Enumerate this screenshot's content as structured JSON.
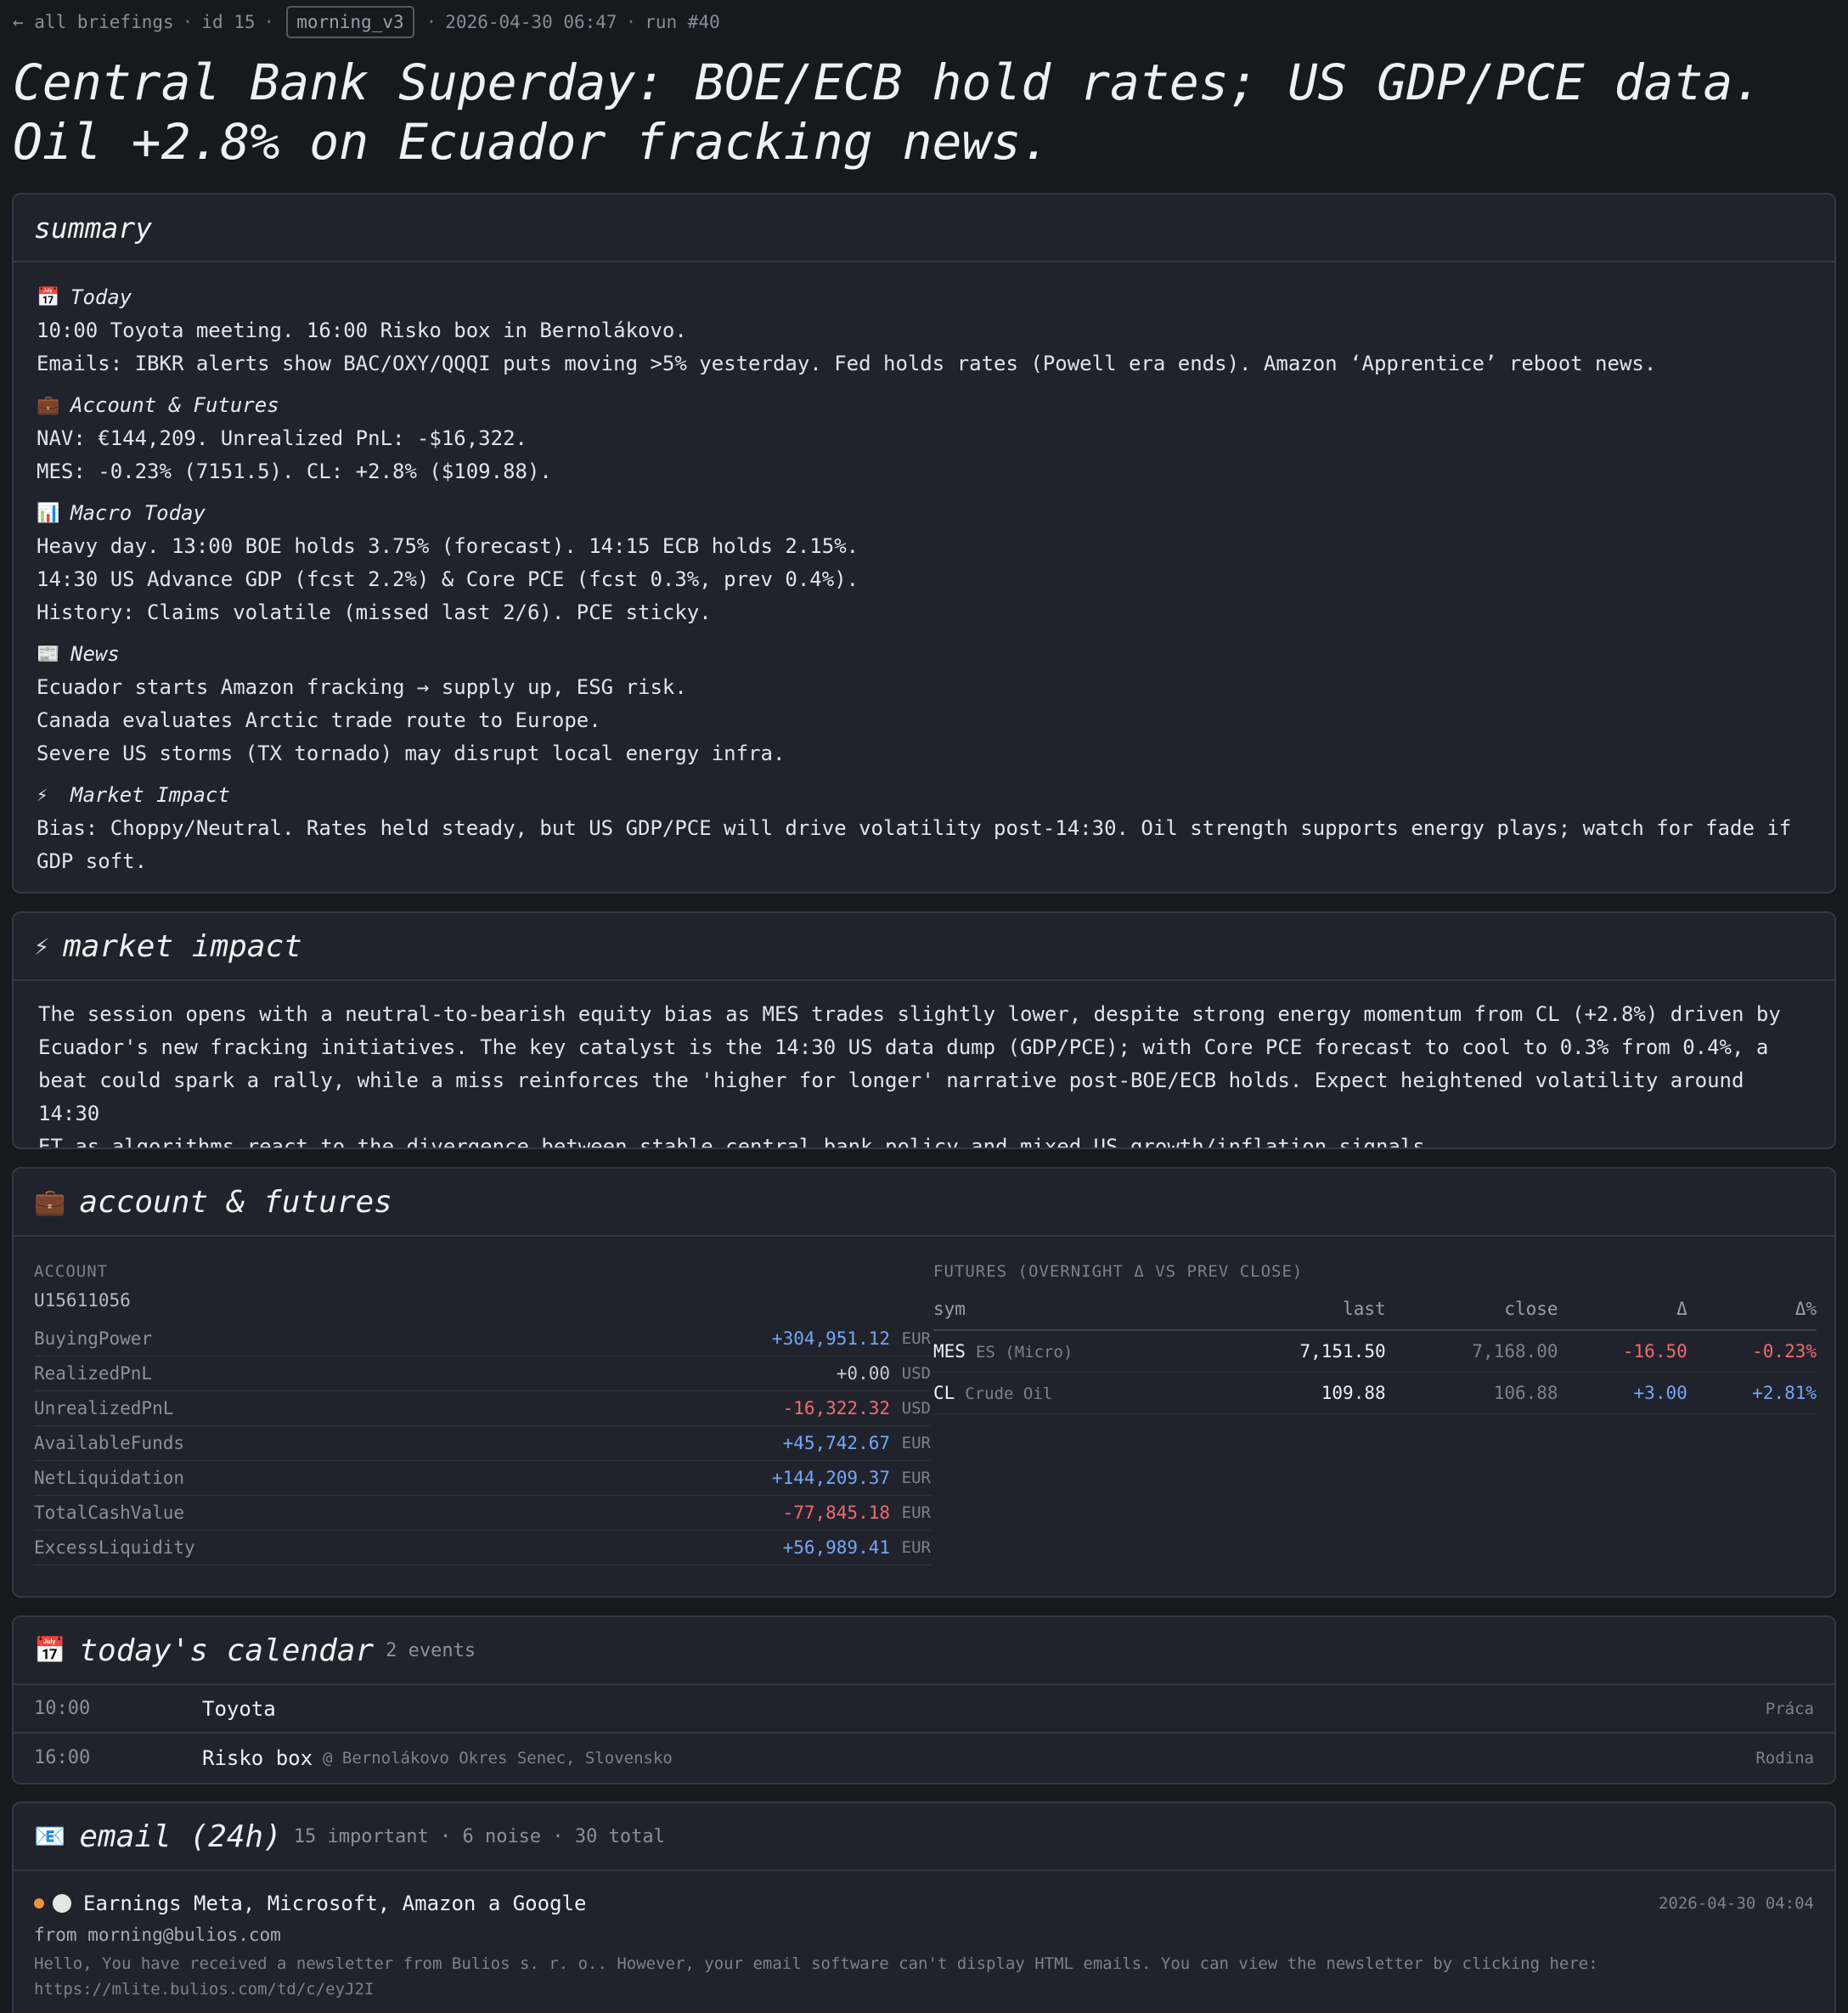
{
  "topbar": {
    "back": "← all briefings",
    "id": "id 15",
    "tag": "morning_v3",
    "timestamp": "2026-04-30 06:47",
    "run": "run #40"
  },
  "headline": "Central Bank Superday: BOE/ECB hold rates; US GDP/PCE data. Oil +2.8% on Ecuador fracking news.",
  "summary": {
    "title": "summary",
    "today_title": "Today",
    "today_lines": [
      "10:00 Toyota meeting. 16:00 Risko box in Bernolákovo.",
      "Emails: IBKR alerts show BAC/OXY/QQQI puts moving >5% yesterday. Fed holds rates (Powell era ends). Amazon ‘Apprentice’ reboot news."
    ],
    "account_title": "Account & Futures",
    "account_lines": [
      "NAV: €144,209. Unrealized PnL: -$16,322.",
      "MES: -0.23% (7151.5). CL: +2.8% ($109.88)."
    ],
    "macro_title": "Macro Today",
    "macro_lines": [
      "Heavy day. 13:00 BOE holds 3.75% (forecast). 14:15 ECB holds 2.15%.",
      "14:30 US Advance GDP (fcst 2.2%) & Core PCE (fcst 0.3%, prev 0.4%).",
      "History: Claims volatile (missed last 2/6). PCE sticky."
    ],
    "news_title": "News",
    "news_lines": [
      "Ecuador starts Amazon fracking → supply up, ESG risk.",
      "Canada evaluates Arctic trade route to Europe.",
      "Severe US storms (TX tornado) may disrupt local energy infra."
    ],
    "impact_title": "Market Impact",
    "impact_lines": [
      "Bias: Choppy/Neutral. Rates held steady, but US GDP/PCE will drive volatility post-14:30. Oil strength supports energy plays; watch for fade if",
      "GDP soft."
    ]
  },
  "market_impact": {
    "title": "market impact",
    "lines": [
      "The session opens with a neutral-to-bearish equity bias as MES trades slightly lower, despite strong energy momentum from CL (+2.8%) driven by",
      "Ecuador's new fracking initiatives. The key catalyst is the 14:30 US data dump (GDP/PCE); with Core PCE forecast to cool to 0.3% from 0.4%, a",
      "beat could spark a rally, while a miss reinforces the 'higher for longer' narrative post-BOE/ECB holds. Expect heightened volatility around 14:30",
      "ET as algorithms react to the divergence between stable central bank policy and mixed US growth/inflation signals."
    ]
  },
  "account_futures": {
    "title": "account & futures",
    "account_caption": "ACCOUNT",
    "account_id": "U15611056",
    "rows": [
      {
        "key": "BuyingPower",
        "value": "+304,951.12",
        "cur": "EUR",
        "sign": "pos"
      },
      {
        "key": "RealizedPnL",
        "value": "+0.00",
        "cur": "USD",
        "sign": "neu"
      },
      {
        "key": "UnrealizedPnL",
        "value": "-16,322.32",
        "cur": "USD",
        "sign": "neg"
      },
      {
        "key": "AvailableFunds",
        "value": "+45,742.67",
        "cur": "EUR",
        "sign": "pos"
      },
      {
        "key": "NetLiquidation",
        "value": "+144,209.37",
        "cur": "EUR",
        "sign": "pos"
      },
      {
        "key": "TotalCashValue",
        "value": "-77,845.18",
        "cur": "EUR",
        "sign": "neg"
      },
      {
        "key": "ExcessLiquidity",
        "value": "+56,989.41",
        "cur": "EUR",
        "sign": "pos"
      }
    ],
    "futures_caption": "FUTURES (OVERNIGHT Δ VS PREV CLOSE)",
    "futures_headers": {
      "sym": "sym",
      "last": "last",
      "close": "close",
      "delta": "Δ",
      "pct": "Δ%"
    },
    "futures": [
      {
        "sym": "MES",
        "desc": "ES (Micro)",
        "last": "7,151.50",
        "close": "7,168.00",
        "delta": "-16.50",
        "pct": "-0.23%",
        "sign": "neg"
      },
      {
        "sym": "CL",
        "desc": "Crude Oil",
        "last": "109.88",
        "close": "106.88",
        "delta": "+3.00",
        "pct": "+2.81%",
        "sign": "pos"
      }
    ]
  },
  "calendar": {
    "title": "today's calendar",
    "count": "2 events",
    "events": [
      {
        "time": "10:00",
        "title": "Toyota",
        "location": "",
        "tag": "Práca"
      },
      {
        "time": "16:00",
        "title": "Risko box",
        "location": "@ Bernolákovo Okres Senec, Slovensko",
        "tag": "Rodina"
      }
    ]
  },
  "email": {
    "title": "email (24h)",
    "meta": "15 important · 6 noise · 30 total",
    "items": [
      {
        "subject": "Earnings Meta, Microsoft, Amazon a Google",
        "date": "2026-04-30 04:04",
        "from": "from morning@bulios.com",
        "preview_1": "Hello, You have received a newsletter from Bulios s. r. o.. However, your email software can't display HTML emails. You can view the newsletter by clicking here:",
        "preview_2": "https://mlite.bulios.com/td/c/eyJ2I"
      }
    ]
  },
  "icons": {
    "today": "calendar-icon",
    "account": "briefcase-icon",
    "macro": "bar-chart-icon",
    "news": "newspaper-icon",
    "impact": "lightning-icon",
    "email": "envelope-icon",
    "unread_dot": "#f0913d"
  }
}
